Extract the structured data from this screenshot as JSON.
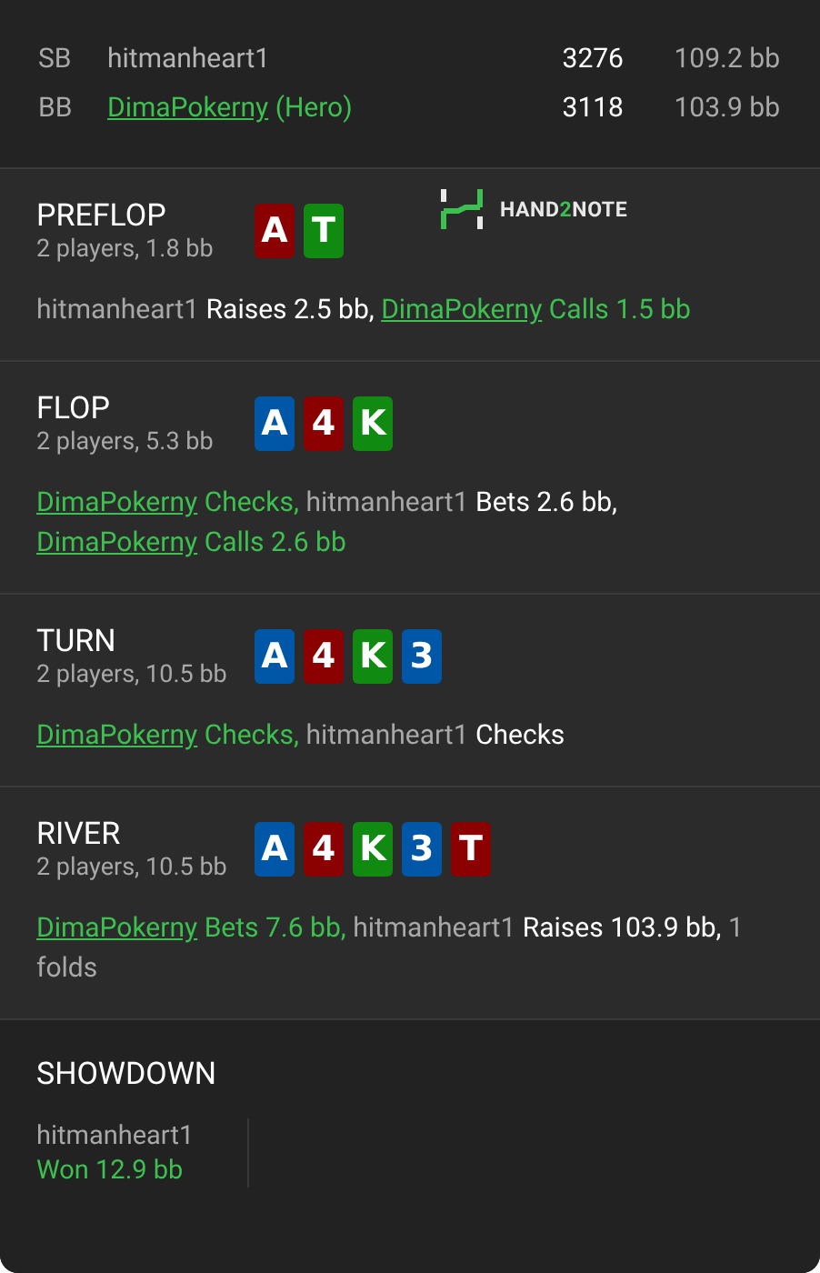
{
  "seats": [
    {
      "position": "SB",
      "player": "hitmanheart1",
      "hero": false,
      "stack": "3276",
      "stack_bb": "109.2 bb"
    },
    {
      "position": "BB",
      "player": "DimaPokerny",
      "hero": true,
      "hero_tag": "(Hero)",
      "stack": "3118",
      "stack_bb": "103.9 bb"
    }
  ],
  "streets": [
    {
      "name": "PREFLOP",
      "info": "2 players, 1.8 bb",
      "cards": [
        {
          "rank": "A",
          "color": "#8b0000"
        },
        {
          "rank": "T",
          "color": "#118a11"
        }
      ],
      "logo": [
        {
          "text": "HAND",
          "accent": false
        },
        {
          "text": "2",
          "accent": true
        },
        {
          "text": "NOTE",
          "accent": false
        }
      ],
      "actions": [
        {
          "kind": "player",
          "text": "hitmanheart1"
        },
        {
          "kind": "action",
          "text": " Raises 2.5 bb, "
        },
        {
          "kind": "hero-link",
          "text": "DimaPokerny"
        },
        {
          "kind": "hero-action",
          "text": " Calls 1.5 bb"
        }
      ]
    },
    {
      "name": "FLOP",
      "info": "2 players, 5.3 bb",
      "cards": [
        {
          "rank": "A",
          "color": "#0057a8"
        },
        {
          "rank": "4",
          "color": "#8b0000"
        },
        {
          "rank": "K",
          "color": "#118a11"
        }
      ],
      "actions": [
        {
          "kind": "hero-link",
          "text": "DimaPokerny"
        },
        {
          "kind": "hero-action",
          "text": " Checks, "
        },
        {
          "kind": "player",
          "text": "hitmanheart1"
        },
        {
          "kind": "action",
          "text": " Bets 2.6 bb, "
        },
        {
          "kind": "hero-link",
          "text": "DimaPokerny"
        },
        {
          "kind": "hero-action",
          "text": " Calls 2.6 bb"
        }
      ]
    },
    {
      "name": "TURN",
      "info": "2 players, 10.5 bb",
      "cards": [
        {
          "rank": "A",
          "color": "#0057a8"
        },
        {
          "rank": "4",
          "color": "#8b0000"
        },
        {
          "rank": "K",
          "color": "#118a11"
        },
        {
          "rank": "3",
          "color": "#0057a8"
        }
      ],
      "actions": [
        {
          "kind": "hero-link",
          "text": "DimaPokerny"
        },
        {
          "kind": "hero-action",
          "text": " Checks, "
        },
        {
          "kind": "player",
          "text": "hitmanheart1"
        },
        {
          "kind": "action",
          "text": " Checks"
        }
      ]
    },
    {
      "name": "RIVER",
      "info": "2 players, 10.5 bb",
      "cards": [
        {
          "rank": "A",
          "color": "#0057a8"
        },
        {
          "rank": "4",
          "color": "#8b0000"
        },
        {
          "rank": "K",
          "color": "#118a11"
        },
        {
          "rank": "3",
          "color": "#0057a8"
        },
        {
          "rank": "T",
          "color": "#8b0000"
        }
      ],
      "actions": [
        {
          "kind": "hero-link",
          "text": "DimaPokerny"
        },
        {
          "kind": "hero-action",
          "text": " Bets 7.6 bb, "
        },
        {
          "kind": "player",
          "text": "hitmanheart1"
        },
        {
          "kind": "action",
          "text": " Raises 103.9 bb, "
        },
        {
          "kind": "player",
          "text": "1 folds"
        }
      ]
    }
  ],
  "showdown": {
    "title": "SHOWDOWN",
    "winners": [
      {
        "player": "hitmanheart1",
        "result": "Won 12.9 bb"
      }
    ]
  }
}
